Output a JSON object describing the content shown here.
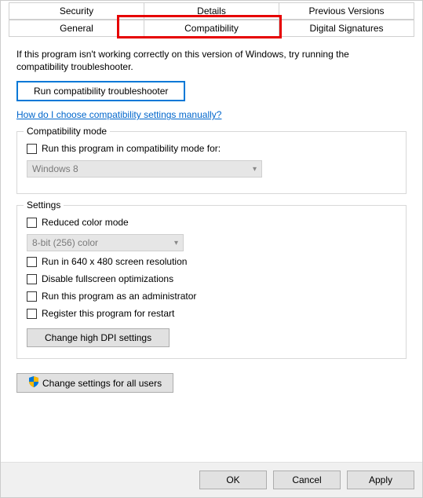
{
  "tabs": {
    "row1": [
      "Security",
      "Details",
      "Previous Versions"
    ],
    "row2": [
      "General",
      "Compatibility",
      "Digital Signatures"
    ],
    "active": "Compatibility"
  },
  "intro": "If this program isn't working correctly on this version of Windows, try running the compatibility troubleshooter.",
  "run_troubleshooter": "Run compatibility troubleshooter",
  "help_link": "How do I choose compatibility settings manually?",
  "compat_mode": {
    "title": "Compatibility mode",
    "checkbox": "Run this program in compatibility mode for:",
    "selected": "Windows 8"
  },
  "settings": {
    "title": "Settings",
    "reduced_color": "Reduced color mode",
    "color_selected": "8-bit (256) color",
    "run_640": "Run in 640 x 480 screen resolution",
    "disable_fullscreen": "Disable fullscreen optimizations",
    "run_admin": "Run this program as an administrator",
    "register_restart": "Register this program for restart",
    "change_dpi": "Change high DPI settings"
  },
  "all_users": "Change settings for all users",
  "footer": {
    "ok": "OK",
    "cancel": "Cancel",
    "apply": "Apply"
  }
}
